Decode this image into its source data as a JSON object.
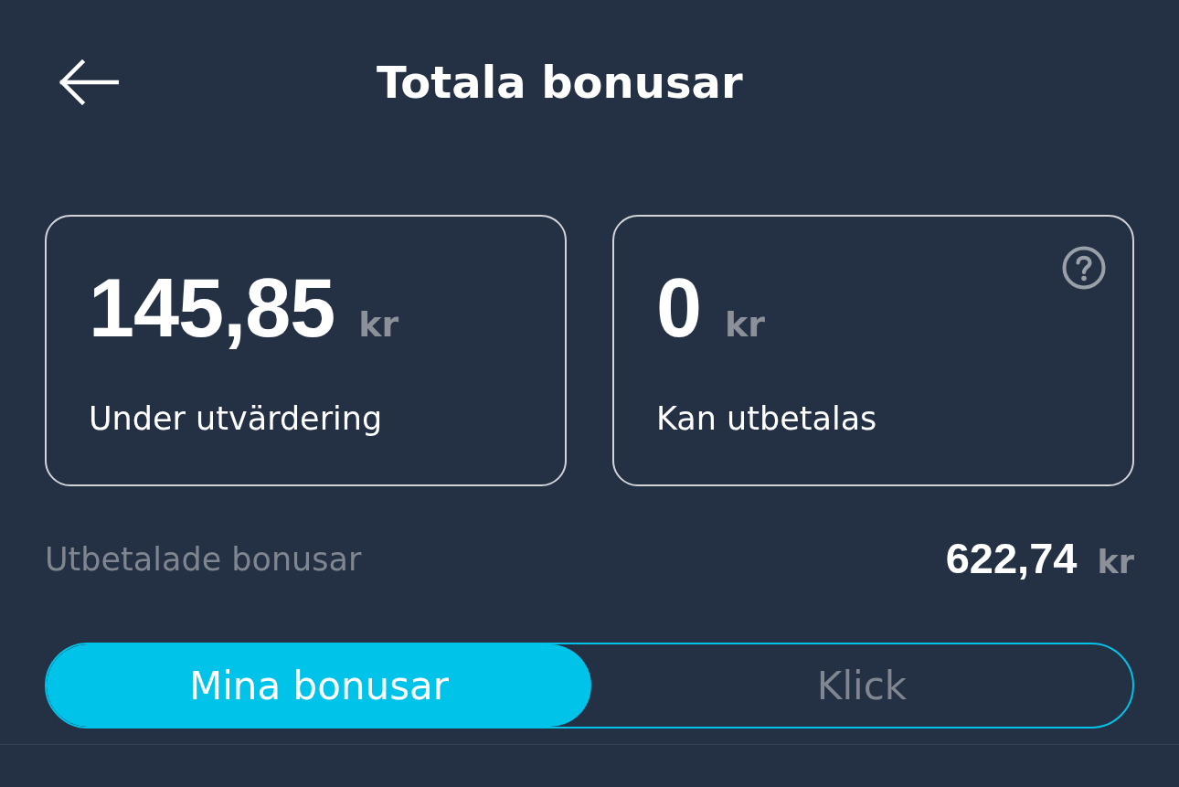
{
  "header": {
    "title": "Totala bonusar"
  },
  "cards": [
    {
      "amount": "145,85",
      "currency": "kr",
      "label": "Under utvärdering",
      "help": false
    },
    {
      "amount": "0",
      "currency": "kr",
      "label": "Kan utbetalas",
      "help": true
    }
  ],
  "paid": {
    "label": "Utbetalade bonusar",
    "amount": "622,74",
    "currency": "kr"
  },
  "segments": [
    {
      "label": "Mina bonusar",
      "selected": true
    },
    {
      "label": "Klick",
      "selected": false
    }
  ]
}
